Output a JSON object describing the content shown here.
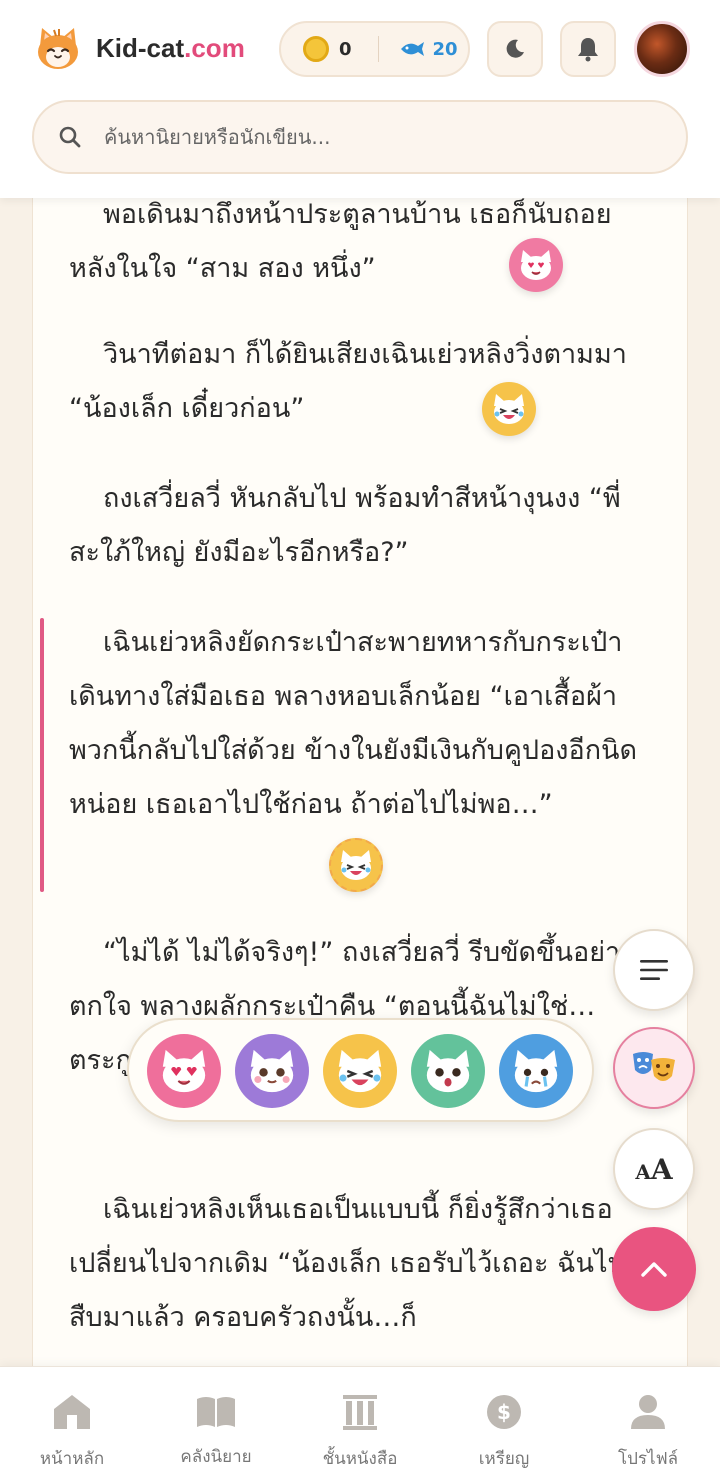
{
  "header": {
    "brand_name": "Kid-cat",
    "brand_tld": ".com",
    "coins": "0",
    "fish": "20"
  },
  "search": {
    "placeholder": "ค้นหานิยายหรือนักเขียน..."
  },
  "reader": {
    "paragraphs": [
      {
        "text": "พอเดินมาถึงหน้าประตูลานบ้าน เธอก็นับถอยหลังในใจ “สาม สอง หนึ่ง”",
        "reaction": "heart-eyes-cat"
      },
      {
        "text": "วินาทีต่อมา ก็ได้ยินเสียงเฉินเย่วหลิงวิ่งตามมา “น้องเล็ก เดี๋ยวก่อน”",
        "reaction": "laughing-cat"
      },
      {
        "text": "ถงเสวี่ยลวี่ หันกลับไป พร้อมทำสีหน้างุนงง “พี่สะใภ้ใหญ่ ยังมีอะไรอีกหรือ?”",
        "reaction": ""
      },
      {
        "text": "เฉินเย่วหลิงยัดกระเป๋าสะพายทหารกับกระเป๋าเดินทางใส่มือเธอ พลางหอบเล็กน้อย “เอาเสื้อผ้าพวกนี้กลับไปใส่ด้วย ข้างในยังมีเงินกับคูปองอีกนิดหน่อย เธอเอาไปใช้ก่อน ถ้าต่อไปไม่พอ…”",
        "reaction": "laughing-cat"
      },
      {
        "text": "“ไม่ได้ ไม่ได้จริงๆ!” ถงเสวี่ยลวี่ รีบขัดขึ้นอย่างตกใจ พลางผลักกระเป๋าคืน “ตอนนี้ฉันไม่ใช่… ตระกูลถงไม่ได้",
        "reaction": ""
      },
      {
        "text": "เฉินเย่วหลิงเห็นเธอเป็นแบบนี้ ก็ยิ่งรู้สึกว่าเธอเปลี่ยนไปจากเดิม “น้องเล็ก เธอรับไว้เถอะ ฉันไปสืบมาแล้ว ครอบครัวถงนั้น…ก็",
        "reaction": ""
      }
    ]
  },
  "emoji_picker": {
    "options": [
      "heart-eyes-cat",
      "blushing-cat",
      "laughing-cat",
      "surprised-cat",
      "crying-cat"
    ]
  },
  "fabs": {
    "aa_label": "AA"
  },
  "bottom_nav": {
    "items": [
      {
        "label": "หน้าหลัก",
        "icon": "home-icon"
      },
      {
        "label": "คลังนิยาย",
        "icon": "book-icon"
      },
      {
        "label": "ชั้นหนังสือ",
        "icon": "shelf-icon"
      },
      {
        "label": "เหรียญ",
        "icon": "coin-icon"
      },
      {
        "label": "โปรไฟล์",
        "icon": "user-icon"
      }
    ]
  },
  "colors": {
    "accent": "#e95480",
    "background": "#f8f1e7",
    "paper": "#fffdf8"
  }
}
